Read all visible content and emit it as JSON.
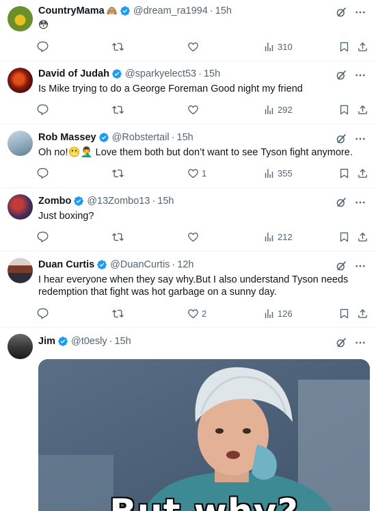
{
  "tweets": [
    {
      "name": "CountryMama",
      "name_emoji": "🙈",
      "handle": "@dream_ra1994",
      "time": "15h",
      "text": "😳",
      "replies": "",
      "reposts": "",
      "likes": "",
      "views": "310",
      "avatar_color": "#6b8f2a"
    },
    {
      "name": "David of Judah",
      "handle": "@sparkyelect53",
      "time": "15h",
      "text": "Is Mike trying to do a George Foreman Good night my friend",
      "replies": "",
      "reposts": "",
      "likes": "",
      "views": "292",
      "avatar_color": "#8a1a0f"
    },
    {
      "name": "Rob Massey",
      "handle": "@Robstertail",
      "time": "15h",
      "text": "Oh no!😬🤦‍♂️ Love them both but don’t want to see Tyson fight anymore.",
      "replies": "",
      "reposts": "",
      "likes": "1",
      "views": "355",
      "avatar_color": "#9db4c7"
    },
    {
      "name": "Zombo",
      "handle": "@13Zombo13",
      "time": "15h",
      "text": "Just boxing?",
      "replies": "",
      "reposts": "",
      "likes": "",
      "views": "212",
      "avatar_color": "#4b2f5a"
    },
    {
      "name": "Duan Curtis",
      "handle": "@DuanCurtis",
      "time": "12h",
      "text": "I hear everyone when they say why.But I also understand Tyson needs redemption that fight was hot garbage on a sunny day.",
      "replies": "",
      "reposts": "",
      "likes": "2",
      "views": "126",
      "avatar_color": "#7a3b2a"
    },
    {
      "name": "Jim",
      "handle": "@t0esly",
      "time": "15h",
      "text": "",
      "media_caption": "But why?",
      "avatar_color": "#3a3a3a"
    }
  ],
  "colors": {
    "verified": "#1d9bf0",
    "secondary": "#536471",
    "divider": "#eff3f4"
  },
  "icons": [
    "reply-icon",
    "repost-icon",
    "like-icon",
    "views-icon",
    "bookmark-icon",
    "share-icon",
    "grok-icon",
    "more-icon",
    "verified-badge-icon"
  ]
}
